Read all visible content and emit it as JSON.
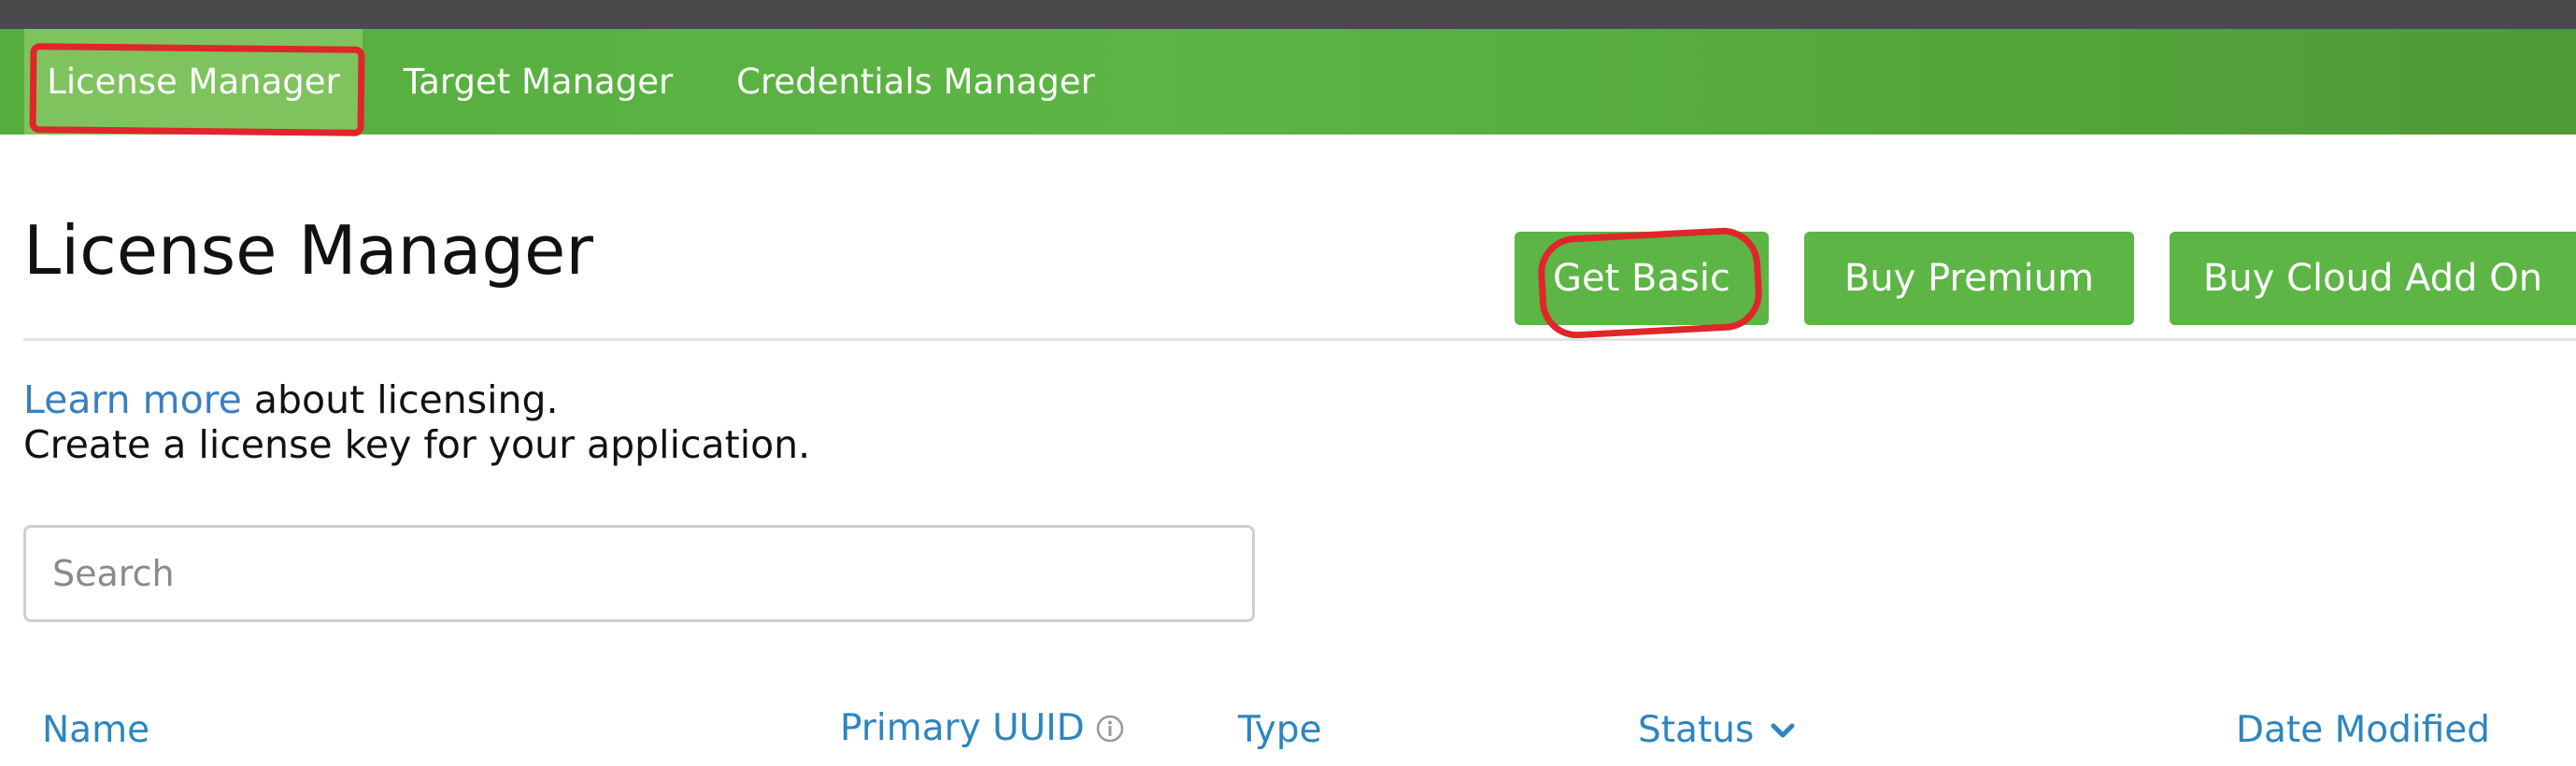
{
  "nav": {
    "items": [
      {
        "label": "License Manager",
        "active": true
      },
      {
        "label": "Target Manager",
        "active": false
      },
      {
        "label": "Credentials Manager",
        "active": false
      }
    ]
  },
  "page": {
    "title": "License Manager"
  },
  "actions": {
    "get_basic": "Get Basic",
    "buy_premium": "Buy Premium",
    "buy_cloud": "Buy Cloud Add On"
  },
  "info": {
    "link_text": "Learn more",
    "link_suffix": " about licensing.",
    "line2": "Create a license key for your application."
  },
  "search": {
    "placeholder": "Search",
    "value": ""
  },
  "table": {
    "columns": [
      "Name",
      "Primary UUID",
      "Type",
      "Status",
      "Date Modified"
    ]
  },
  "icons": {
    "uuid_info": "info-circle-icon",
    "status_sort": "chevron-down-icon"
  },
  "colors": {
    "brand_green": "#5cb544",
    "link_blue": "#3b7fbf",
    "header_blue": "#2c85c1",
    "annotation_red": "#e0262a"
  }
}
